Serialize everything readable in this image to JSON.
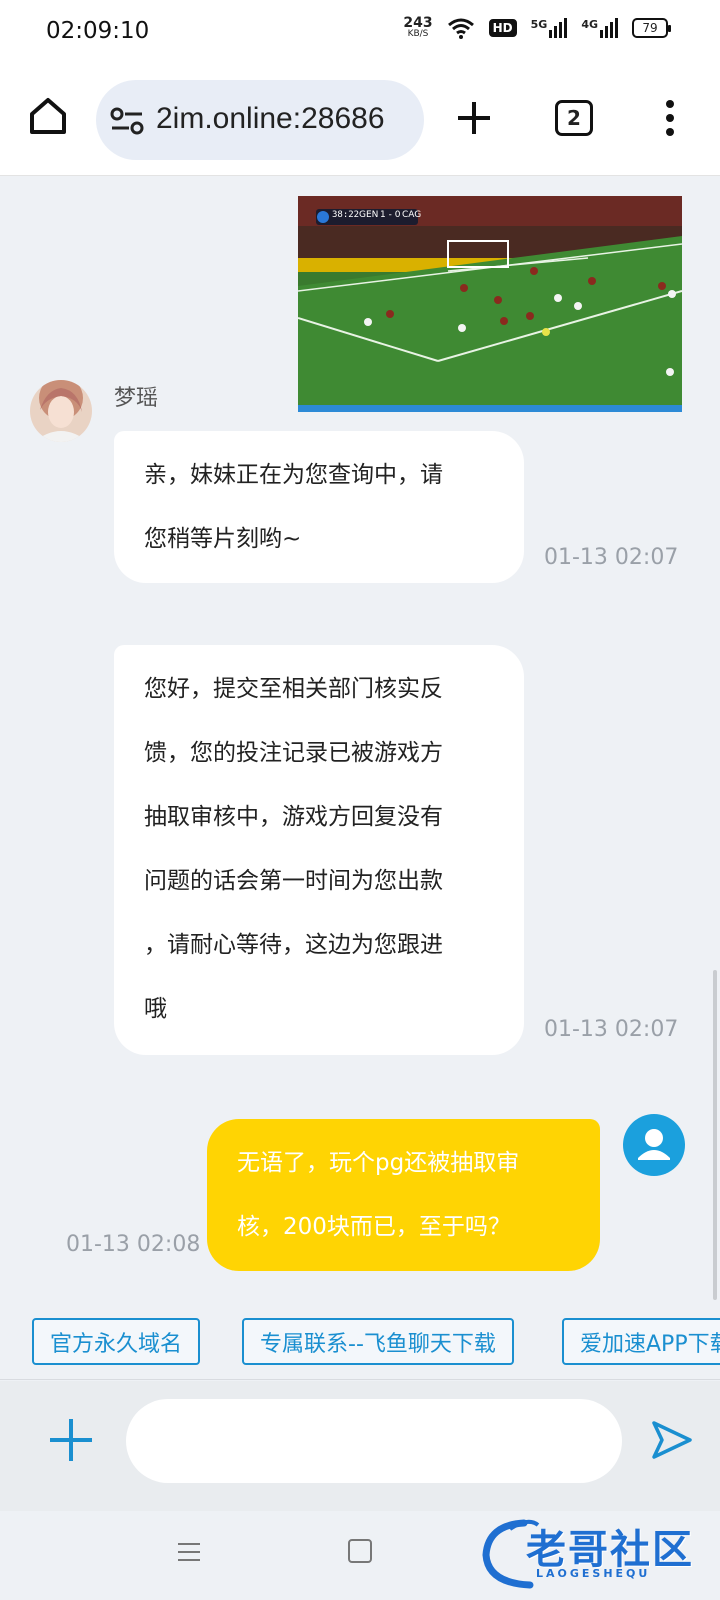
{
  "status_bar": {
    "time": "02:09:10",
    "net_speed_value": "243",
    "net_speed_unit": "KB/S",
    "hd_label": "HD",
    "sim1_label": "5G",
    "sim2_label": "4G",
    "battery_level": "79"
  },
  "browser": {
    "url": "2im.online:28686",
    "tab_count": "2",
    "icons": [
      "home-icon",
      "site-settings-icon",
      "plus-icon",
      "tab-switcher-icon",
      "more-vert-icon"
    ]
  },
  "chat": {
    "sender_name": "梦瑶",
    "messages": [
      {
        "from": "agent",
        "text": "亲，妹妹正在为您查询中，请\n您稍等片刻哟~",
        "time": "01-13 02:07"
      },
      {
        "from": "agent",
        "text": "您好，提交至相关部门核实反\n馈，您的投注记录已被游戏方\n抽取审核中，游戏方回复没有\n问题的话会第一时间为您出款\n，请耐心等待，这边为您跟进\n哦",
        "time": "01-13 02:07"
      },
      {
        "from": "user",
        "text": "无语了，玩个pg还被抽取审\n核，200块而已，至于吗？",
        "time": "01-13 02:08"
      }
    ],
    "scoreboard": {
      "clock": "38:22",
      "home": "GEN",
      "score": "1 - 0",
      "away": "CAG"
    }
  },
  "quick_links": [
    "官方永久域名",
    "专属联系--飞鱼聊天下载",
    "爱加速APP下载"
  ],
  "composer": {
    "placeholder": "",
    "value": ""
  },
  "watermark": {
    "title": "老哥社区",
    "subtitle": "LAOGESHEQU"
  },
  "colors": {
    "accent": "#1a8fd0",
    "user_bubble": "#ffd403",
    "background": "#eef1f5"
  }
}
